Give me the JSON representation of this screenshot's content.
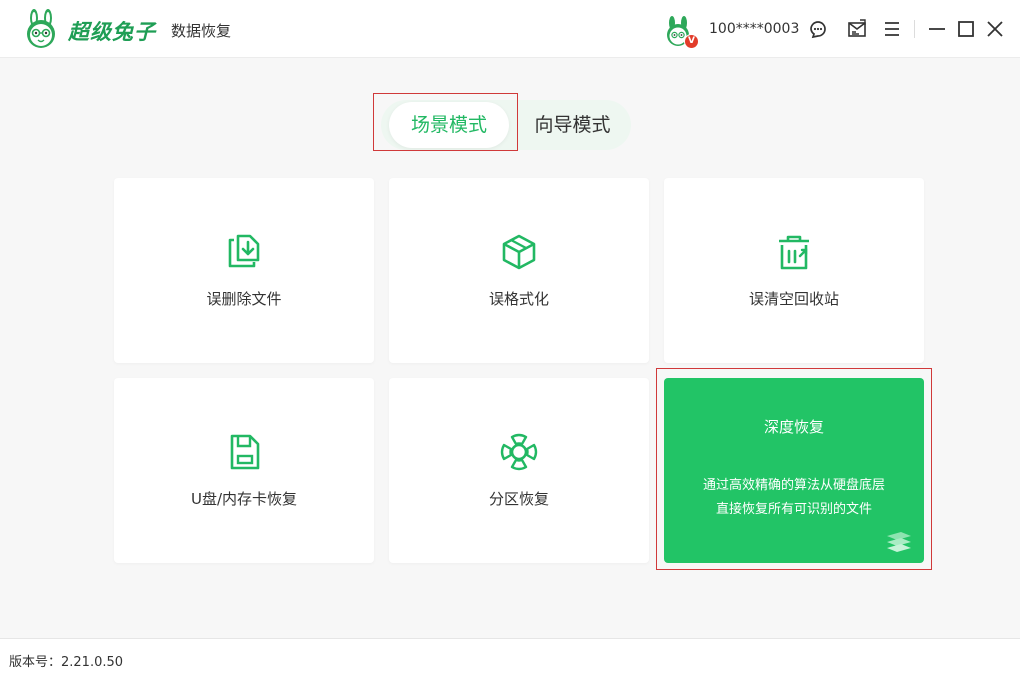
{
  "app": {
    "brand": "超级兔子",
    "subtitle": "数据恢复",
    "account": "100****0003",
    "vip_badge": "V"
  },
  "icons": {
    "logo": "rabbit-logo-icon",
    "avatar": "rabbit-avatar-icon",
    "support": "customer-service-icon",
    "feedback": "feedback-icon",
    "menu": "menu-icon",
    "minimize": "minimize-icon",
    "maximize": "maximize-icon",
    "close": "close-icon"
  },
  "tabs": [
    {
      "label": "场景模式",
      "active": true
    },
    {
      "label": "向导模式",
      "active": false
    }
  ],
  "cards": [
    {
      "label": "误删除文件",
      "icon": "file-restore-icon"
    },
    {
      "label": "误格式化",
      "icon": "cube-icon"
    },
    {
      "label": "误清空回收站",
      "icon": "recycle-bin-icon"
    },
    {
      "label": "U盘/内存卡恢复",
      "icon": "sd-card-icon"
    },
    {
      "label": "分区恢复",
      "icon": "partition-icon"
    }
  ],
  "deep_recovery": {
    "title": "深度恢复",
    "desc_line1": "通过高效精确的算法从硬盘底层",
    "desc_line2": "直接恢复所有可识别的文件",
    "icon": "layers-icon"
  },
  "footer": {
    "version": "版本号：2.21.0.50"
  },
  "colors": {
    "accent": "#22c466",
    "brand": "#1f9e55",
    "highlight_border": "#d0393a"
  }
}
